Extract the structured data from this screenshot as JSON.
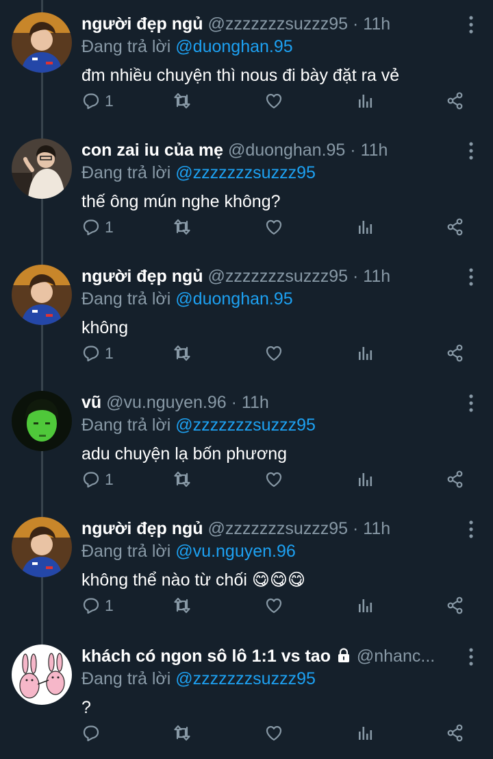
{
  "reply_prefix": "Đang trả lời",
  "tweets": [
    {
      "name": "người đẹp ngủ",
      "handle": "@zzzzzzzsuzzz95",
      "dot": "·",
      "time": "11h",
      "reply_to": "@duonghan.95",
      "text": "đm nhiều chuyện thì nous đi bày đặt ra vẻ",
      "reply_count": "1",
      "avatar_icon": "boy-blue-jersey-avatar"
    },
    {
      "name": "con zai iu của mẹ",
      "handle": "@duonghan.95",
      "dot": "·",
      "time": "11h",
      "reply_to": "@zzzzzzzsuzzz95",
      "text": "thế ông mún nghe không?",
      "reply_count": "1",
      "avatar_icon": "person-white-hoodie-avatar"
    },
    {
      "name": "người đẹp ngủ",
      "handle": "@zzzzzzzsuzzz95",
      "dot": "·",
      "time": "11h",
      "reply_to": "@duonghan.95",
      "text": "không",
      "reply_count": "1",
      "avatar_icon": "boy-blue-jersey-avatar"
    },
    {
      "name": "vũ",
      "handle": "@vu.nguyen.96",
      "dot": "·",
      "time": "11h",
      "reply_to": "@zzzzzzzsuzzz95",
      "text": "adu chuyện lạ bốn phương",
      "reply_count": "1",
      "avatar_icon": "green-face-avatar"
    },
    {
      "name": "người đẹp ngủ",
      "handle": "@zzzzzzzsuzzz95",
      "dot": "·",
      "time": "11h",
      "reply_to": "@vu.nguyen.96",
      "text": "không thể nào từ chối",
      "emojis": "😋😋😋",
      "reply_count": "1",
      "avatar_icon": "boy-blue-jersey-avatar"
    },
    {
      "name": "khách có ngon sô lô 1:1 vs tao",
      "handle": "@nhanc...",
      "reply_to": "@zzzzzzzsuzzz95",
      "text": "?",
      "reply_count": "",
      "protected": true,
      "avatar_icon": "pink-rabbits-avatar"
    }
  ],
  "colors": {
    "background": "#15202b",
    "secondary_text": "#8899a6",
    "mention": "#1da1f2",
    "thread_line": "#38444d"
  },
  "icons": {
    "reply": "reply-icon",
    "retweet": "retweet-icon",
    "like": "heart-icon",
    "analytics": "analytics-icon",
    "share": "share-icon",
    "more": "more-vertical-icon",
    "lock": "lock-icon"
  }
}
